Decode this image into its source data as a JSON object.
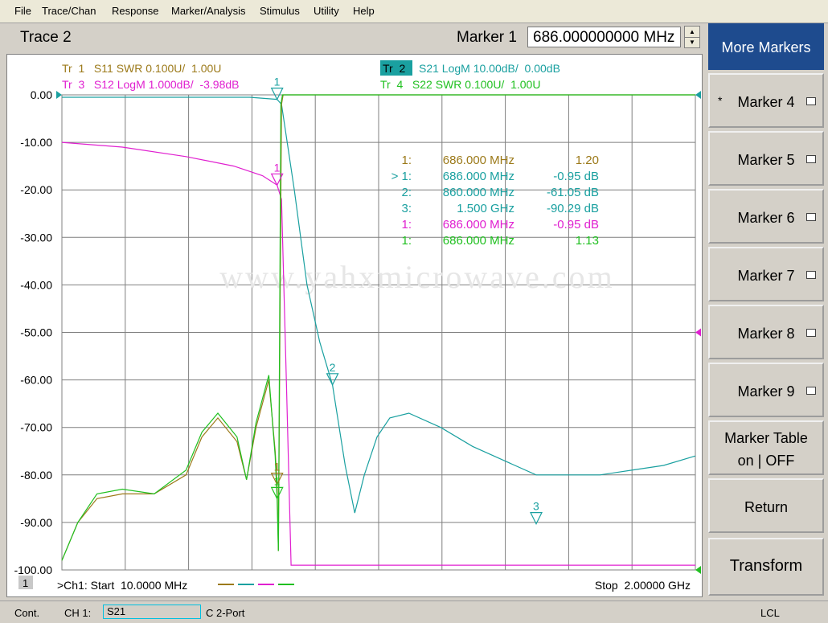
{
  "menu": [
    "File",
    "Trace/Chan",
    "Response",
    "Marker/Analysis",
    "Stimulus",
    "Utility",
    "Help"
  ],
  "header": {
    "trace_title": "Trace 2",
    "marker_label": "Marker 1",
    "marker_value": "686.000000000 MHz"
  },
  "traces": {
    "tr1": "Tr  1   S11 SWR 0.100U/  1.00U",
    "tr2_tag": "Tr  2",
    "tr2": "S21 LogM 10.00dB/  0.00dB",
    "tr3": "Tr  3   S12 LogM 1.000dB/  -3.98dB",
    "tr4": "Tr  4   S22 SWR 0.100U/  1.00U"
  },
  "marker_table": [
    {
      "id": "1:",
      "freq": "686.000 MHz",
      "value": "1.20",
      "color": "#9c7a1a"
    },
    {
      "id": "> 1:",
      "freq": "686.000 MHz",
      "value": "-0.95 dB",
      "color": "#1aa0a0"
    },
    {
      "id": "2:",
      "freq": "860.000 MHz",
      "value": "-61.05 dB",
      "color": "#1aa0a0"
    },
    {
      "id": "3:",
      "freq": "1.500 GHz",
      "value": "-90.29 dB",
      "color": "#1aa0a0"
    },
    {
      "id": "1:",
      "freq": "686.000 MHz",
      "value": "-0.95 dB",
      "color": "#e020d0"
    },
    {
      "id": "1:",
      "freq": "686.000 MHz",
      "value": "1.13",
      "color": "#20c020"
    }
  ],
  "chart_data": {
    "type": "line",
    "x_start_mhz": 10,
    "x_stop_mhz": 2000,
    "ylim": [
      -100,
      0
    ],
    "y_ticks": [
      "0.00",
      "-10.00",
      "-20.00",
      "-30.00",
      "-40.00",
      "-50.00",
      "-60.00",
      "-70.00",
      "-80.00",
      "-90.00",
      "-100.00"
    ],
    "grid": true,
    "series": [
      {
        "name": "S21 LogM",
        "color": "#1aa0a0",
        "points": [
          [
            10,
            -0.5
          ],
          [
            600,
            -0.5
          ],
          [
            686,
            -0.95
          ],
          [
            700,
            -2
          ],
          [
            740,
            -20
          ],
          [
            780,
            -40
          ],
          [
            820,
            -52
          ],
          [
            860,
            -61.05
          ],
          [
            900,
            -78
          ],
          [
            930,
            -88
          ],
          [
            960,
            -80
          ],
          [
            1000,
            -72
          ],
          [
            1040,
            -68
          ],
          [
            1100,
            -67
          ],
          [
            1200,
            -70
          ],
          [
            1300,
            -74
          ],
          [
            1400,
            -77
          ],
          [
            1500,
            -80
          ],
          [
            1600,
            -80
          ],
          [
            1700,
            -80
          ],
          [
            1800,
            -79
          ],
          [
            1900,
            -78
          ],
          [
            2000,
            -76
          ]
        ]
      },
      {
        "name": "S12 LogM",
        "color": "#e020d0",
        "points": [
          [
            10,
            -10
          ],
          [
            200,
            -11
          ],
          [
            400,
            -13
          ],
          [
            550,
            -15
          ],
          [
            640,
            -17
          ],
          [
            686,
            -19
          ],
          [
            700,
            -22
          ],
          [
            715,
            -60
          ],
          [
            730,
            -99
          ],
          [
            2000,
            -99
          ]
        ]
      },
      {
        "name": "S11 SWR",
        "color": "#9c7a1a",
        "points": [
          [
            10,
            -98
          ],
          [
            60,
            -90
          ],
          [
            120,
            -85
          ],
          [
            200,
            -84
          ],
          [
            300,
            -84
          ],
          [
            400,
            -80
          ],
          [
            450,
            -72
          ],
          [
            500,
            -68
          ],
          [
            560,
            -73
          ],
          [
            590,
            -81
          ],
          [
            620,
            -70
          ],
          [
            660,
            -60
          ],
          [
            680,
            -75
          ],
          [
            686,
            -82
          ],
          [
            690,
            -96
          ],
          [
            700,
            -2
          ],
          [
            705,
            0
          ],
          [
            2000,
            0
          ]
        ]
      },
      {
        "name": "S22 SWR",
        "color": "#20c020",
        "points": [
          [
            10,
            -98
          ],
          [
            60,
            -90
          ],
          [
            120,
            -84
          ],
          [
            200,
            -83
          ],
          [
            300,
            -84
          ],
          [
            400,
            -79
          ],
          [
            450,
            -71
          ],
          [
            500,
            -67
          ],
          [
            560,
            -72
          ],
          [
            590,
            -81
          ],
          [
            620,
            -69
          ],
          [
            660,
            -59
          ],
          [
            680,
            -76
          ],
          [
            686,
            -85
          ],
          [
            690,
            -96
          ],
          [
            698,
            -2
          ],
          [
            703,
            0
          ],
          [
            2000,
            0
          ]
        ]
      }
    ],
    "markers": [
      {
        "label": "1",
        "x": 686,
        "y": -0.95,
        "color": "#1aa0a0"
      },
      {
        "label": "1",
        "x": 686,
        "y": -19,
        "color": "#e020d0"
      },
      {
        "label": "2",
        "x": 860,
        "y": -61.05,
        "color": "#1aa0a0"
      },
      {
        "label": "3",
        "x": 1500,
        "y": -90.29,
        "color": "#1aa0a0"
      },
      {
        "label": "1",
        "x": 686,
        "y": -82,
        "color": "#9c7a1a"
      },
      {
        "label": "1",
        "x": 686,
        "y": -85,
        "color": "#20c020"
      }
    ]
  },
  "footer": {
    "channel_num": "1",
    "start": ">Ch1: Start  10.0000 MHz",
    "stop": "Stop  2.00000 GHz"
  },
  "watermark": "www.yahxmicrowave.com",
  "softkeys": [
    {
      "label": "More Markers"
    },
    {
      "label": "Marker 4",
      "prefix": "*"
    },
    {
      "label": "Marker 5"
    },
    {
      "label": "Marker 6"
    },
    {
      "label": "Marker 7"
    },
    {
      "label": "Marker 8"
    },
    {
      "label": "Marker 9"
    },
    {
      "label": "Marker Table",
      "label2": "on | OFF"
    },
    {
      "label": "Return"
    },
    {
      "label": "Transform"
    }
  ],
  "status": {
    "mode": "Cont.",
    "channel": "CH 1:",
    "param": "S21",
    "port": "C  2-Port",
    "remote": "LCL"
  },
  "colors": {
    "s11": "#9c7a1a",
    "s21": "#1aa0a0",
    "s12": "#e020d0",
    "s22": "#20c020",
    "softkey_active": "#1e4b8e"
  }
}
